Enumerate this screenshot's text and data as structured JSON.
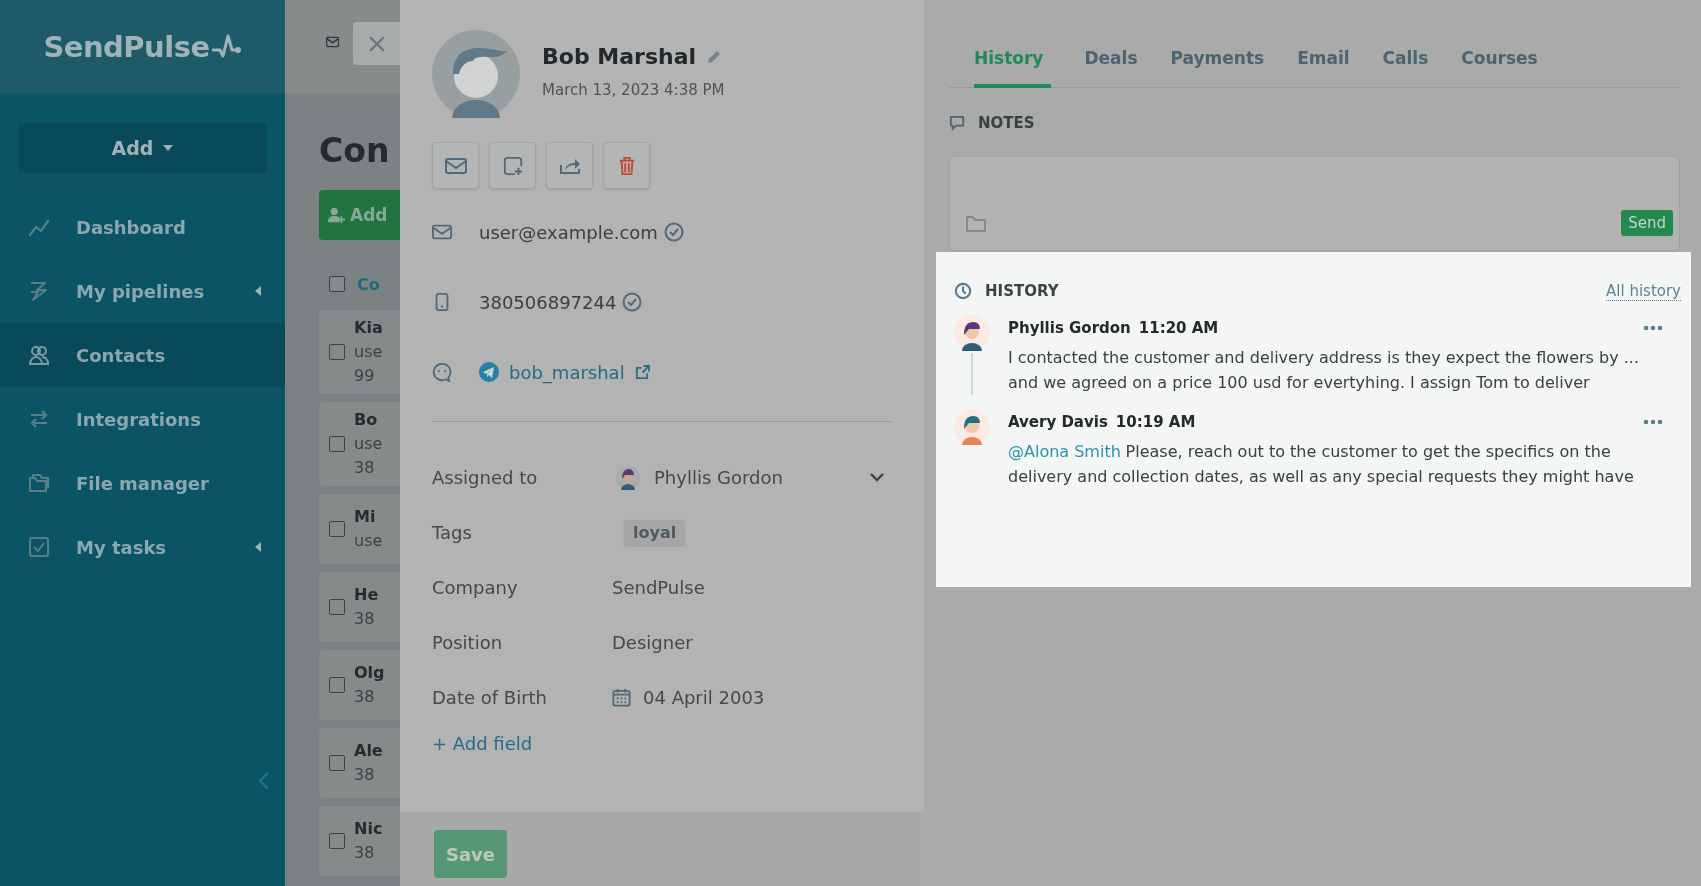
{
  "sidebar": {
    "logo": "SendPulse",
    "add_button": "Add",
    "items": [
      {
        "label": "Dashboard",
        "selected": false,
        "submenu": false
      },
      {
        "label": "My pipelines",
        "selected": false,
        "submenu": true
      },
      {
        "label": "Contacts",
        "selected": true,
        "submenu": false
      },
      {
        "label": "Integrations",
        "selected": false,
        "submenu": false
      },
      {
        "label": "File manager",
        "selected": false,
        "submenu": false
      },
      {
        "label": "My tasks",
        "selected": false,
        "submenu": true
      }
    ]
  },
  "contacts_list": {
    "title": "Con",
    "add_button": "Add",
    "header": "Co",
    "header_checked": false,
    "rows": [
      {
        "checked": false,
        "lines": [
          "Kia",
          "use",
          "99"
        ]
      },
      {
        "checked": false,
        "lines": [
          "Bo",
          "use",
          "38"
        ]
      },
      {
        "checked": false,
        "lines": [
          "Mi",
          "use"
        ]
      },
      {
        "checked": false,
        "lines": [
          "He",
          "38"
        ]
      },
      {
        "checked": false,
        "lines": [
          "Olg",
          "38"
        ]
      },
      {
        "checked": false,
        "lines": [
          "Ale",
          "38"
        ]
      },
      {
        "checked": false,
        "lines": [
          "Nic",
          "38"
        ]
      }
    ]
  },
  "contact": {
    "name": "Bob Marshal",
    "created": "March 13, 2023 4:38 PM",
    "email": {
      "value": "user@example.com",
      "verified": true
    },
    "phone": {
      "value": "380506897244",
      "verified": true
    },
    "telegram": "bob_marshal",
    "fields": [
      {
        "label": "Assigned to",
        "kind": "user",
        "value": "Phyllis Gordon"
      },
      {
        "label": "Tags",
        "kind": "tag",
        "value": "loyal"
      },
      {
        "label": "Company",
        "kind": "text",
        "value": "SendPulse"
      },
      {
        "label": "Position",
        "kind": "text",
        "value": "Designer"
      },
      {
        "label": "Date of Birth",
        "kind": "date",
        "value": "04 April 2003"
      }
    ],
    "add_field": "+ Add field",
    "save_button": "Save"
  },
  "tabs": [
    {
      "label": "History",
      "selected": true
    },
    {
      "label": "Deals",
      "selected": false
    },
    {
      "label": "Payments",
      "selected": false
    },
    {
      "label": "Email",
      "selected": false
    },
    {
      "label": "Calls",
      "selected": false
    },
    {
      "label": "Courses",
      "selected": false
    }
  ],
  "notes": {
    "title": "NOTES",
    "send_button": "Send"
  },
  "history": {
    "title": "HISTORY",
    "all_link": "All history",
    "entries": [
      {
        "author": "Phyllis Gordon",
        "time": "11:20 AM",
        "text": "I contacted the customer and delivery address is they expect the flowers by ... and we agreed on a price 100 usd for evertyhing. I assign Tom to deliver"
      },
      {
        "author": "Avery Davis",
        "time": "10:19 AM",
        "mention": "@Alona Smith",
        "text": "Please, reach out to the customer to get the specifics on the delivery and collection dates, as well as any special requests they might have"
      }
    ]
  }
}
